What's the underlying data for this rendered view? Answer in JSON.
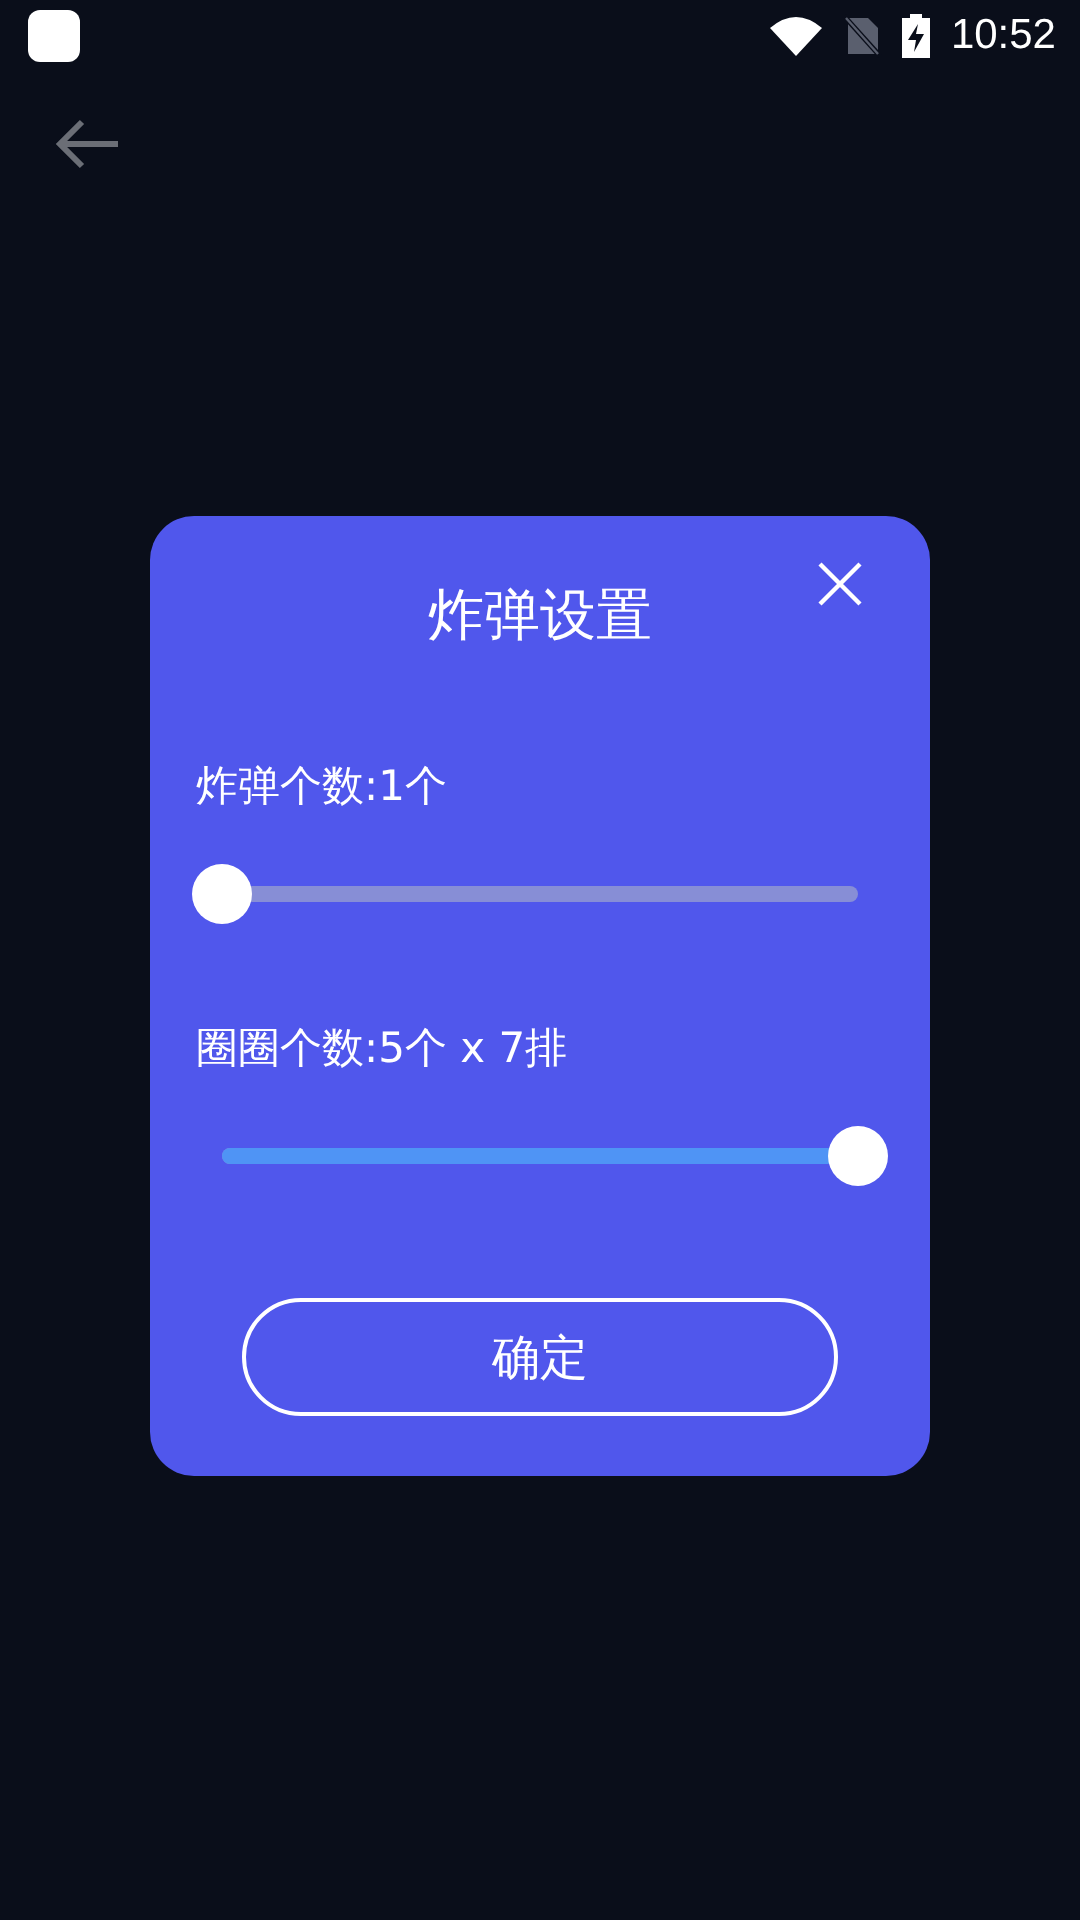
{
  "status_bar": {
    "time": "10:52"
  },
  "dialog": {
    "title": "炸弹设置",
    "sliders": [
      {
        "label": "炸弹个数:1个",
        "level": 0
      },
      {
        "label": "圈圈个数:5个 x 7排",
        "level": 1
      }
    ],
    "confirm_button": "确定"
  }
}
